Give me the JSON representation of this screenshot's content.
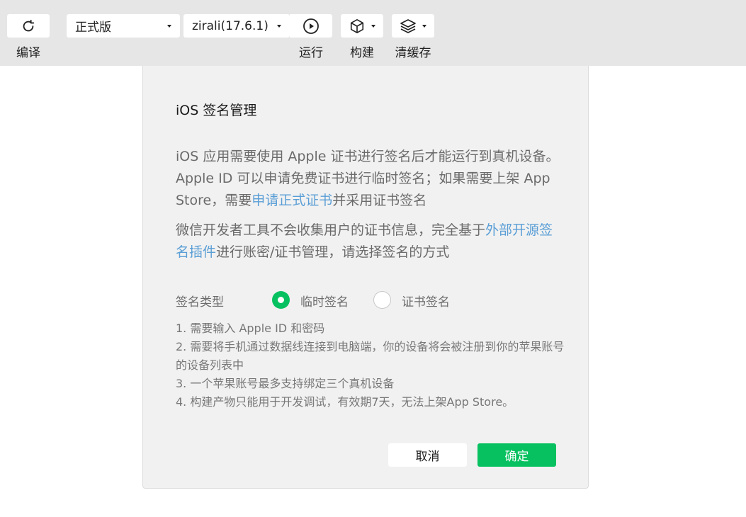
{
  "toolbar": {
    "compile_label": "编译",
    "mode_select_value": "正式版",
    "device_select_value": "zirali(17.6.1)",
    "run_label": "运行",
    "build_label": "构建",
    "clear_cache_label": "清缓存"
  },
  "dialog": {
    "title": "iOS 签名管理",
    "para1": {
      "text_before": "iOS 应用需要使用 Apple 证书进行签名后才能运行到真机设备。Apple ID 可以申请免费证书进行临时签名；如果需要上架 App Store，需要",
      "link": "申请正式证书",
      "text_after": "并采用证书签名"
    },
    "para2": {
      "text_before": "微信开发者工具不会收集用户的证书信息，完全基于",
      "link": "外部开源签名插件",
      "text_after": "进行账密/证书管理，请选择签名的方式"
    },
    "signature_type_label": "签名类型",
    "options": [
      {
        "label": "临时签名",
        "checked": true
      },
      {
        "label": "证书签名",
        "checked": false
      }
    ],
    "notes": [
      "1. 需要输入 Apple ID 和密码",
      "2. 需要将手机通过数据线连接到电脑端，你的设备将会被注册到你的苹果账号的设备列表中",
      "3. 一个苹果账号最多支持绑定三个真机设备",
      "4. 构建产物只能用于开发调试，有效期7天，无法上架App Store。"
    ],
    "cancel_label": "取消",
    "confirm_label": "确定"
  },
  "colors": {
    "accent": "#07c160",
    "link": "#5a9ed6",
    "toolbar_bg": "#e6e6e6",
    "dialog_bg": "#f1f1f1"
  },
  "icons": [
    "refresh-icon",
    "play-icon",
    "cube-icon",
    "layers-icon",
    "caret-down-icon"
  ]
}
